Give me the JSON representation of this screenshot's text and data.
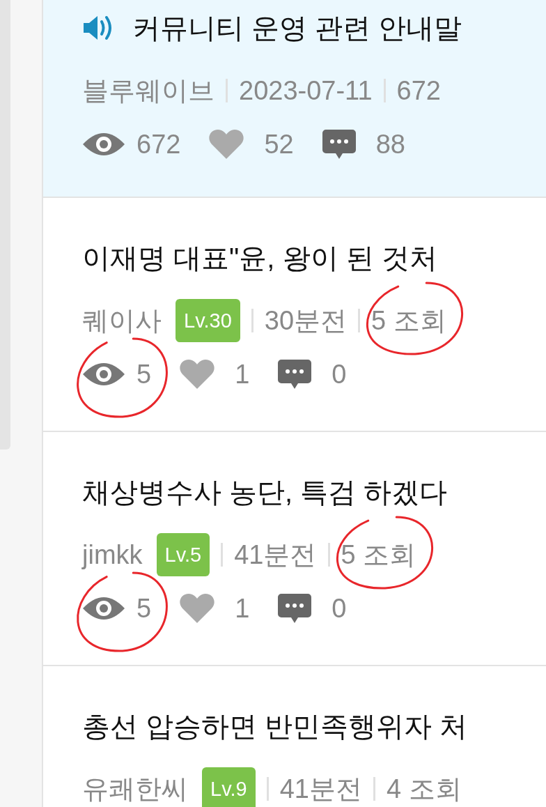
{
  "posts": [
    {
      "kind": "notice",
      "title": "커뮤니티 운영 관련 안내말",
      "author": "블루웨이브",
      "date": "2023-07-11",
      "view_label": "672",
      "views": "672",
      "likes": "52",
      "comments": "88",
      "circled_views": false,
      "circled_view_label": false
    },
    {
      "kind": "post",
      "title": "이재명 대표\"윤, 왕이 된 것처",
      "author": "퀘이사",
      "level": "Lv.30",
      "date": "30분전",
      "view_label": "5 조회",
      "views": "5",
      "likes": "1",
      "comments": "0",
      "circled_views": true,
      "circled_view_label": true
    },
    {
      "kind": "post",
      "title": "채상병수사 농단, 특검 하겠다",
      "author": "jimkk",
      "level": "Lv.5",
      "date": "41분전",
      "view_label": "5 조회",
      "views": "5",
      "likes": "1",
      "comments": "0",
      "circled_views": true,
      "circled_view_label": true
    },
    {
      "kind": "post",
      "title": "총선 압승하면 반민족행위자 처",
      "author": "유쾌한씨",
      "level": "Lv.9",
      "date": "41분전",
      "view_label": "4 조회",
      "circled_views": false,
      "circled_view_label": false
    }
  ]
}
